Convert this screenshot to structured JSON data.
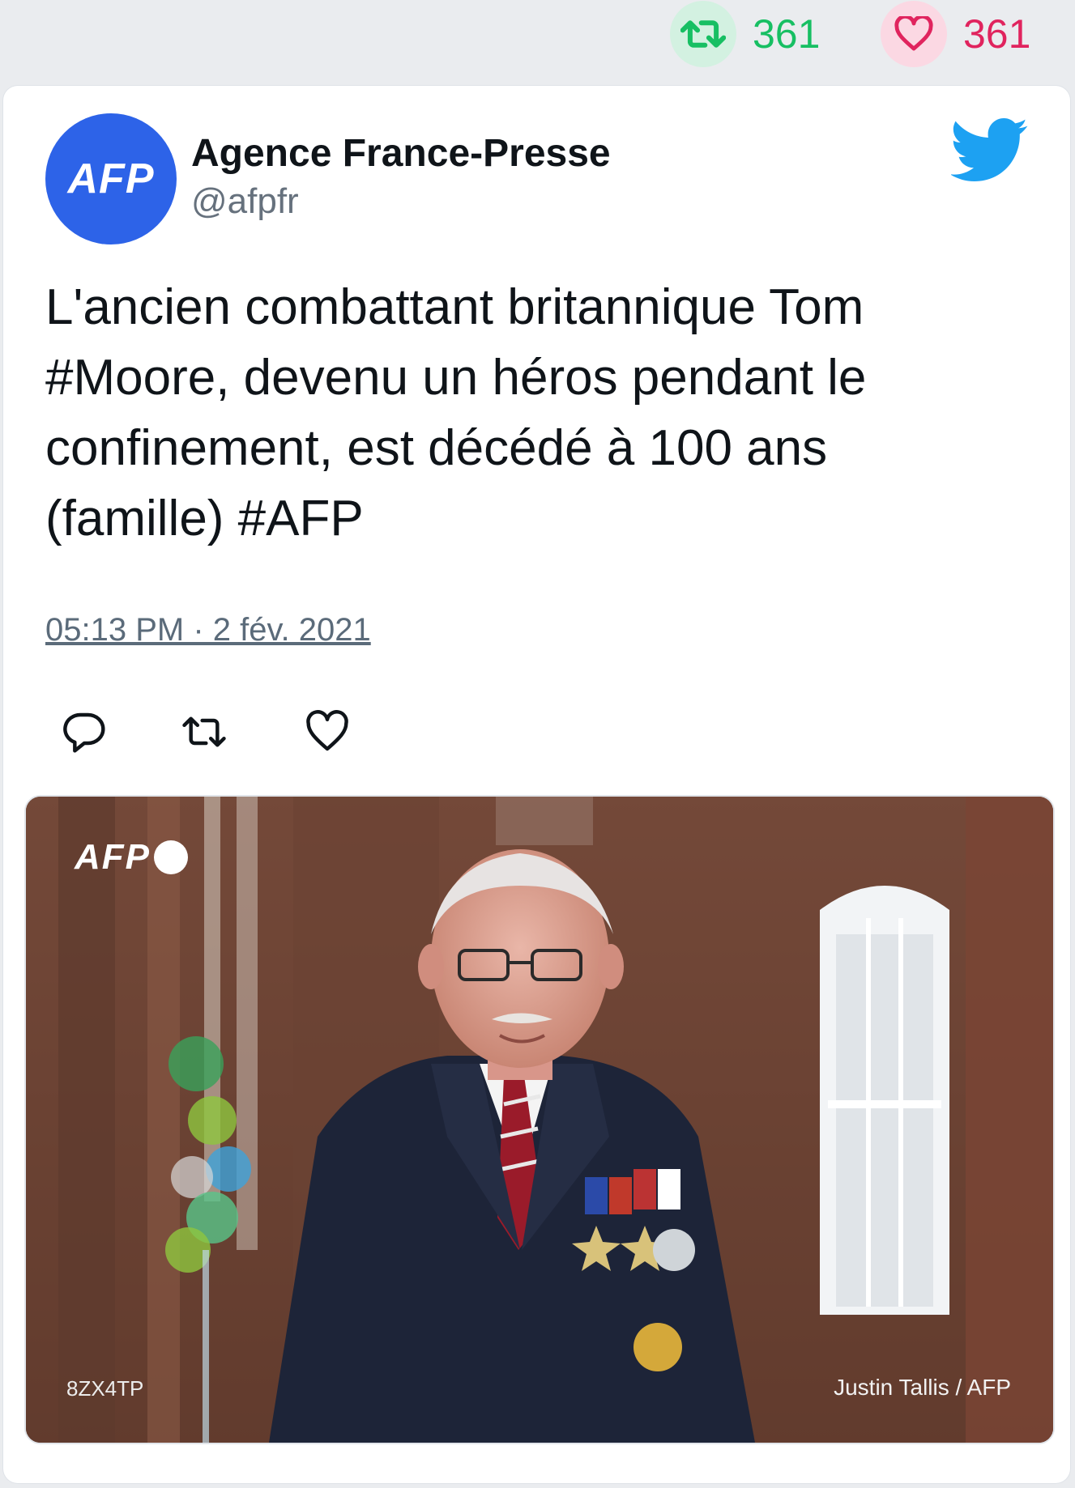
{
  "stats": {
    "retweet_icon": "retweet-icon",
    "retweet_count": "361",
    "like_icon": "heart-icon",
    "like_count": "361"
  },
  "tweet": {
    "author": {
      "avatar_text": "AFP",
      "name": "Agence France-Presse",
      "handle": "@afpfr"
    },
    "platform_icon": "twitter-bird-icon",
    "text": "L'ancien combattant britannique Tom #Moore, devenu un héros pendant le confinement, est décédé à 100 ans (famille) #AFP",
    "timestamp": "05:13 PM · 2 fév. 2021",
    "actions": [
      {
        "icon": "reply-icon"
      },
      {
        "icon": "retweet-icon"
      },
      {
        "icon": "heart-icon"
      }
    ],
    "media": {
      "logo_text": "AFP",
      "code": "8ZX4TP",
      "credit": "Justin Tallis / AFP"
    }
  },
  "colors": {
    "retweet_green": "#17bf63",
    "like_red": "#e0245e",
    "twitter_blue": "#1da1f2",
    "afp_blue": "#2d63e8"
  }
}
